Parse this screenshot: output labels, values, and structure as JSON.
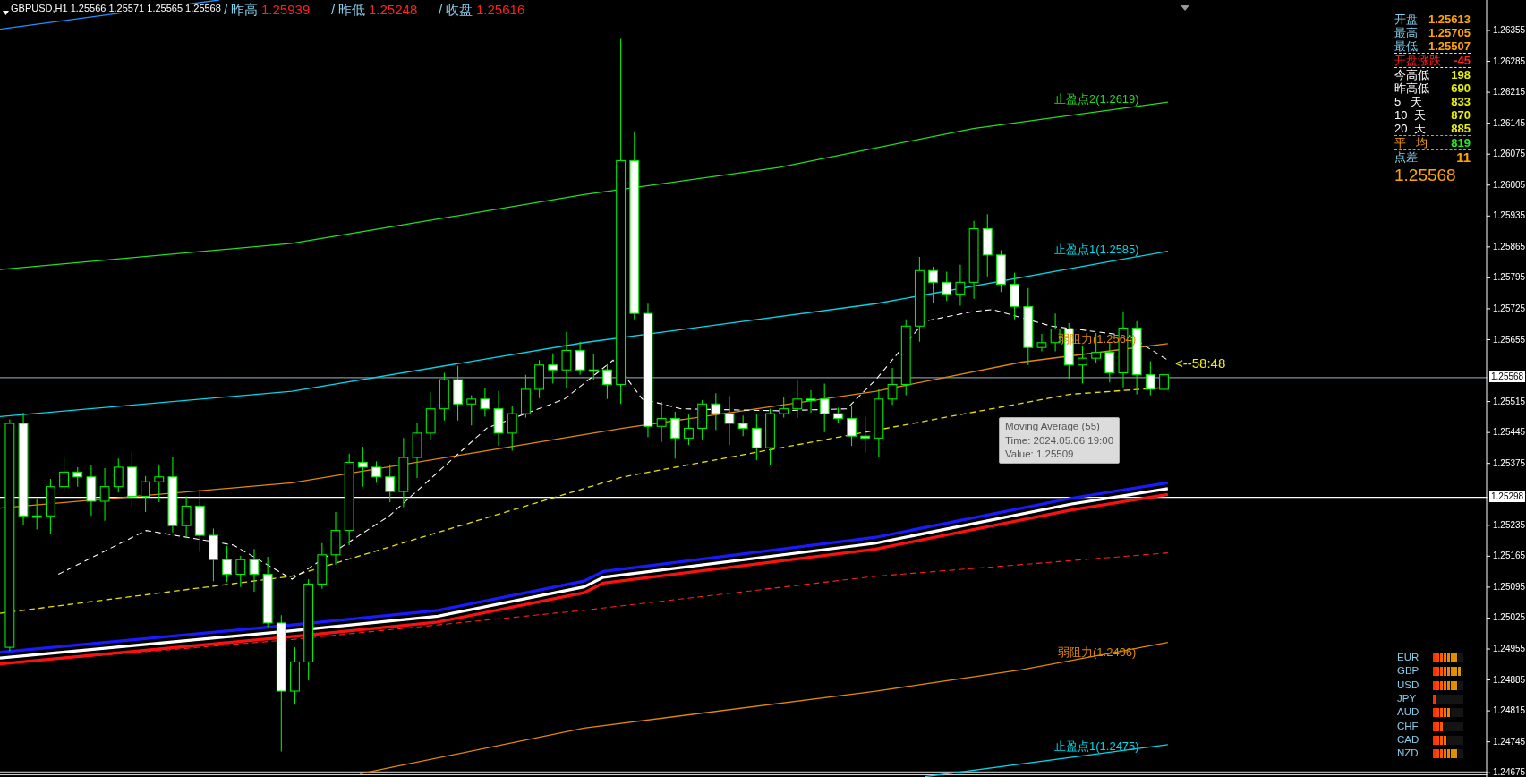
{
  "header": {
    "symbol": "GBPUSD,H1  1.25566 1.25571 1.25565 1.25568",
    "stats": [
      {
        "label": "/ 昨高",
        "value": "1.25939"
      },
      {
        "label": "/ 昨低",
        "value": "1.25248"
      },
      {
        "label": "/ 收盘",
        "value": "1.25616"
      }
    ]
  },
  "chart_labels": [
    {
      "text": "止盈点2(1.2619)",
      "color": "#22dd22"
    },
    {
      "text": "止盈点1(1.2585)",
      "color": "#00d8e8"
    },
    {
      "text": "弱阻力(1.2564)",
      "color": "#e08a00"
    },
    {
      "text": "弱阻力(1.2496)",
      "color": "#e08a00"
    },
    {
      "text": "止盈点1(1.2475)",
      "color": "#00d8e8"
    }
  ],
  "countdown": "<--58:48",
  "tooltip": [
    "Moving Average (55)",
    "Time: 2024.05.06 19:00",
    "Value: 1.25509"
  ],
  "info_panel": {
    "rows": [
      {
        "kind": "price",
        "label": "开盘",
        "value": "1.25613",
        "divider_above": false
      },
      {
        "kind": "price",
        "label": "最高",
        "value": "1.25705",
        "divider_above": false
      },
      {
        "kind": "price",
        "label": "最低",
        "value": "1.25507",
        "divider_above": false
      },
      {
        "kind": "change",
        "label": "开盘涨跌",
        "value": "-45",
        "divider_above": true
      },
      {
        "kind": "range",
        "label": "今高低",
        "value": "198",
        "divider_above": true
      },
      {
        "kind": "range",
        "label": "昨高低",
        "value": "690",
        "divider_above": false
      },
      {
        "kind": "range",
        "label": "5   天",
        "value": "833",
        "divider_above": false
      },
      {
        "kind": "range",
        "label": "10  天",
        "value": "870",
        "divider_above": false
      },
      {
        "kind": "range",
        "label": "20  天",
        "value": "885",
        "divider_above": false
      },
      {
        "kind": "average",
        "label": "平   均",
        "value": "819",
        "divider_above": true
      },
      {
        "kind": "spread",
        "label": "点差",
        "value": "11",
        "divider_above": true
      }
    ],
    "last_price": "1.25568"
  },
  "price_axis": {
    "ticks": [
      "1.26355",
      "1.26285",
      "1.26215",
      "1.26145",
      "1.26075",
      "1.26005",
      "1.25935",
      "1.25865",
      "1.25795",
      "1.25725",
      "1.25655",
      "1.25515",
      "1.25445",
      "1.25375",
      "1.25235",
      "1.25165",
      "1.25095",
      "1.25025",
      "1.24955",
      "1.24885",
      "1.24815",
      "1.24745",
      "1.24675"
    ],
    "badges": [
      "1.25568",
      "1.25298"
    ]
  },
  "currency_strength": [
    {
      "name": "EUR",
      "level": 0.875
    },
    {
      "name": "GBP",
      "level": 1
    },
    {
      "name": "USD",
      "level": 0.875
    },
    {
      "name": "JPY",
      "level": 0.125
    },
    {
      "name": "AUD",
      "level": 0.625
    },
    {
      "name": "CHF",
      "level": 0.375
    },
    {
      "name": "CAD",
      "level": 0.5
    },
    {
      "name": "NZD",
      "level": 0.875
    }
  ]
}
